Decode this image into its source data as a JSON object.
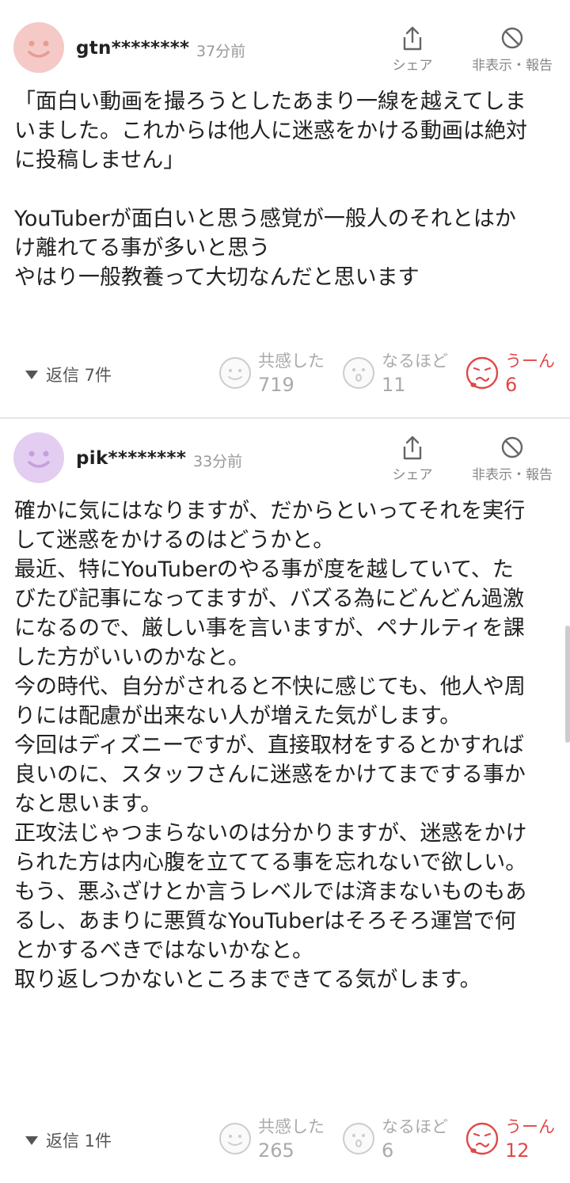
{
  "comments": [
    {
      "user": "gtn********",
      "time": "37分前",
      "share_label": "シェア",
      "hide_report_label": "非表示・報告",
      "body": "「面白い動画を撮ろうとしたあまり一線を越えてしま\nいました。これからは他人に迷惑をかける動画は絶対\nに投稿しません」\n\nYouTuberが面白いと思う感覚が一般人のそれとはか\nけ離れてる事が多いと思う\nやはり一般教養って大切なんだと思います",
      "replies_label": "返信 7件",
      "reactions": [
        {
          "label": "共感した",
          "count": "719"
        },
        {
          "label": "なるほど",
          "count": "11"
        },
        {
          "label": "うーん",
          "count": "6"
        }
      ],
      "avatar_color": "#f5c9c6"
    },
    {
      "user": "pik********",
      "time": "33分前",
      "share_label": "シェア",
      "hide_report_label": "非表示・報告",
      "body": "確かに気にはなりますが、だからといってそれを実行\nして迷惑をかけるのはどうかと。\n最近、特にYouTuberのやる事が度を越していて、た\nびたび記事になってますが、バズる為にどんどん過激\nになるので、厳しい事を言いますが、ペナルティを課\nした方がいいのかなと。\n今の時代、自分がされると不快に感じても、他人や周\nりには配慮が出来ない人が増えた気がします。\n今回はディズニーですが、直接取材をするとかすれば\n良いのに、スタッフさんに迷惑をかけてまでする事か\nなと思います。\n正攻法じゃつまらないのは分かりますが、迷惑をかけ\nられた方は内心腹を立ててる事を忘れないで欲しい。\nもう、悪ふざけとか言うレベルでは済まないものもあ\nるし、あまりに悪質なYouTuberはそろそろ運営で何\nとかするべきではないかなと。\n取り返しつかないところまできてる気がします。",
      "replies_label": "返信 1件",
      "reactions": [
        {
          "label": "共感した",
          "count": "265"
        },
        {
          "label": "なるほど",
          "count": "6"
        },
        {
          "label": "うーん",
          "count": "12"
        }
      ],
      "avatar_color": "#e3cdf0"
    }
  ],
  "colors": {
    "accent_red": "#e04848",
    "muted_gray": "#aaaaaa"
  },
  "icons": {
    "share": "share-icon",
    "hide": "prohibit-icon",
    "empathy": "smile-face-icon",
    "naruhodo": "surprised-face-icon",
    "uun": "troubled-face-icon",
    "replies": "triangle-down-icon"
  }
}
